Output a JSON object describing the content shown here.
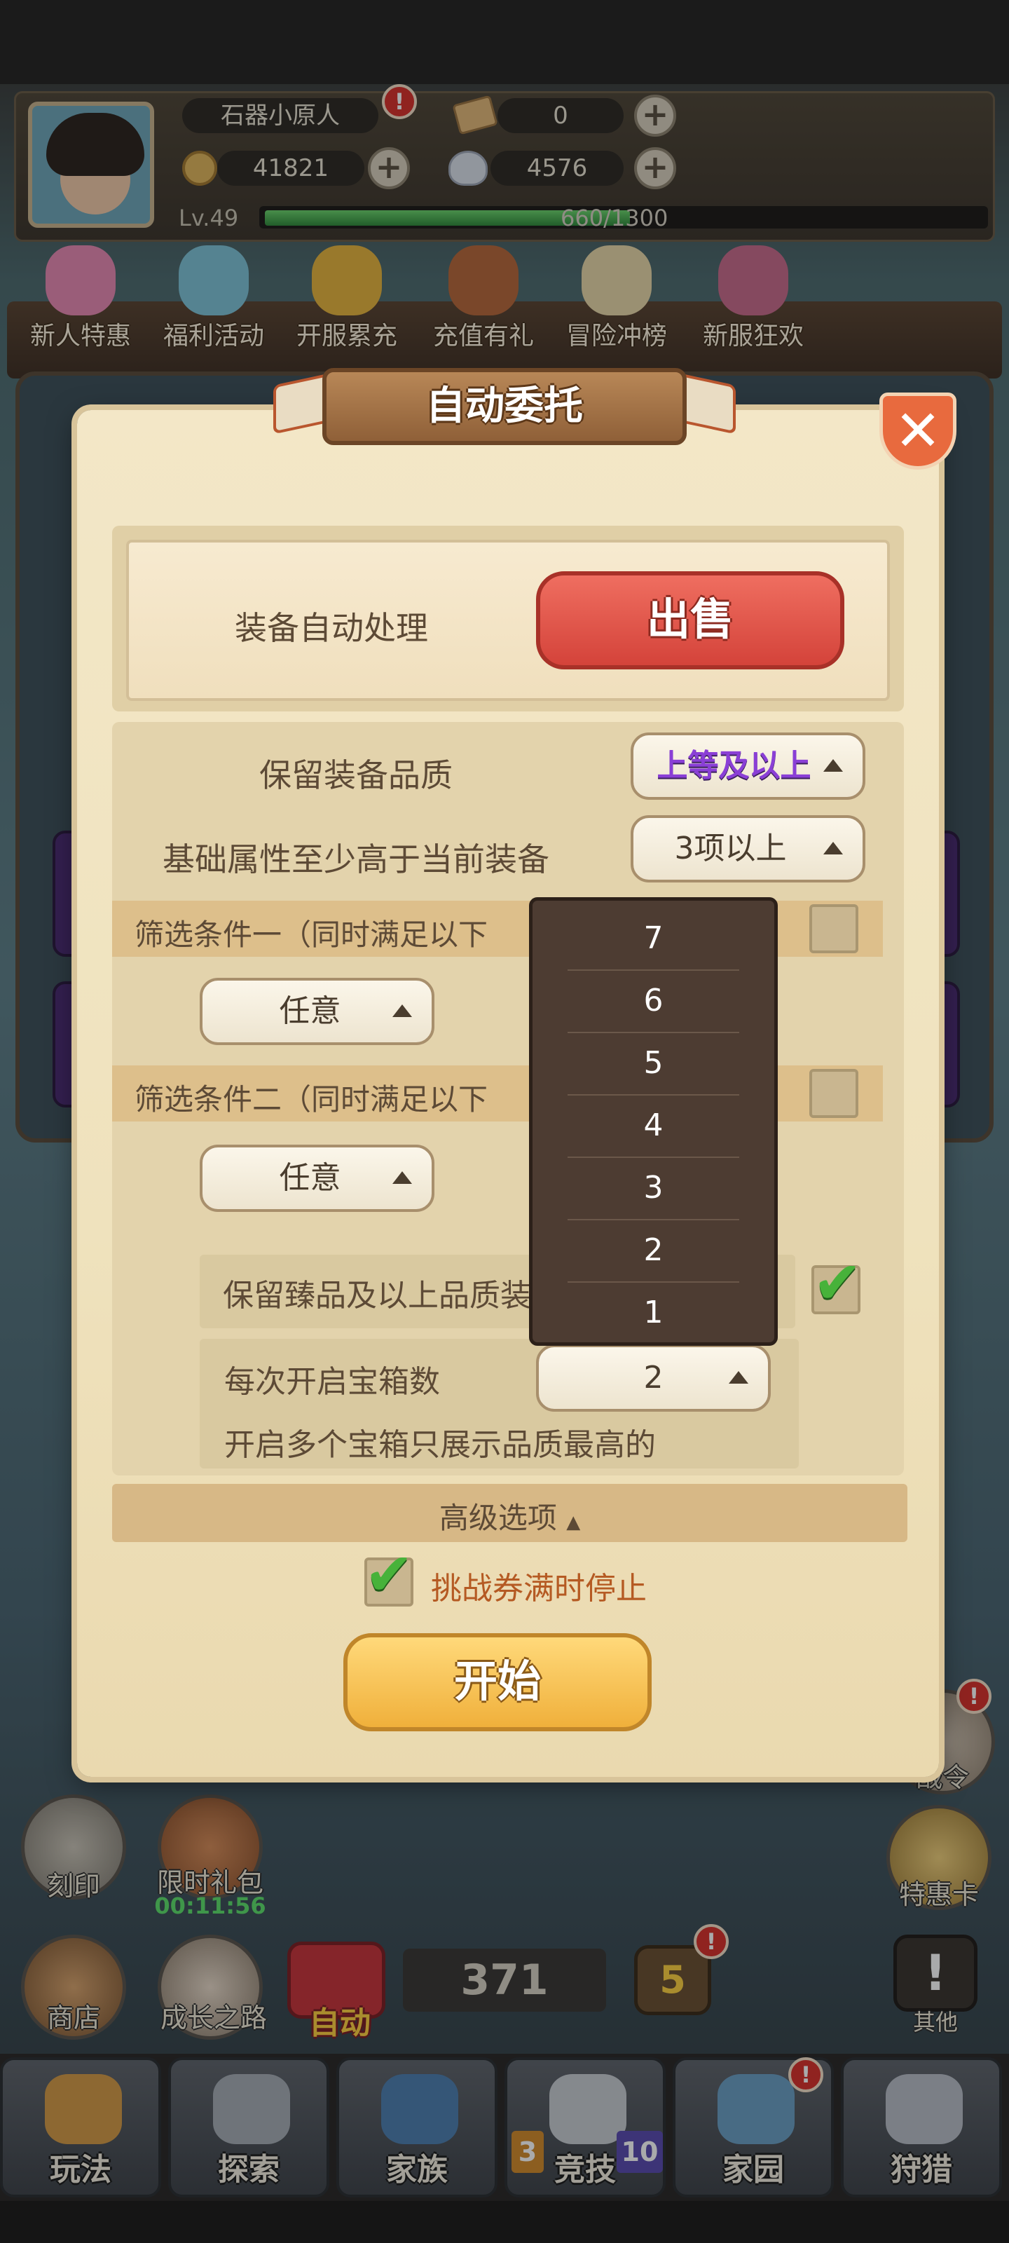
{
  "header": {
    "player_name": "石器小原人",
    "ticket_count": "0",
    "coin_count": "41821",
    "shell_count": "4576",
    "level": "Lv.49",
    "exp": "660/1300",
    "exp_progress": 0.508,
    "name_badge": "!"
  },
  "events": [
    {
      "label": "新人特惠",
      "badge": "!"
    },
    {
      "label": "福利活动"
    },
    {
      "label": "开服累充"
    },
    {
      "label": "充值有礼"
    },
    {
      "label": "冒险冲榜"
    },
    {
      "label": "新服狂欢"
    }
  ],
  "modal": {
    "title": "自动委托",
    "close_icon": "close-icon",
    "equip_auto_label": "装备自动处理",
    "sell_button": "出售",
    "keep_quality_label": "保留装备品质",
    "keep_quality_value": "上等及以上",
    "base_attr_label": "基础属性至少高于当前装备",
    "base_attr_value": "3项以上",
    "filter1_label": "筛选条件一（同时满足以下",
    "filter1_select": "任意",
    "filter2_label": "筛选条件二（同时满足以下",
    "filter2_select": "任意",
    "keep_rare_label": "保留臻品及以上品质装",
    "chests_label": "每次开启宝箱数",
    "chests_value": "2",
    "chests_note": "开启多个宝箱只展示品质最高的",
    "advanced_label": "高级选项",
    "stop_label": "挑战券满时停止",
    "start_button": "开始"
  },
  "dropdown_options": [
    "7",
    "6",
    "5",
    "4",
    "3",
    "2",
    "1"
  ],
  "hud": {
    "engrave": "刻印",
    "limited_pack": "限时礼包",
    "limited_timer": "00:11:56",
    "shop": "商店",
    "growth": "成长之路",
    "auto": "自动",
    "counter": "371",
    "level_badge": "5",
    "battle_pass": "战令",
    "special_card": "特惠卡",
    "other": "其他"
  },
  "tabs": [
    {
      "label": "玩法"
    },
    {
      "label": "探索"
    },
    {
      "label": "家族"
    },
    {
      "label": "竞技",
      "left_num": "3",
      "right_num": "10"
    },
    {
      "label": "家园",
      "badge": "!"
    },
    {
      "label": "狩猎"
    }
  ],
  "colors": {
    "sell_red": "#d4433a",
    "start_gold": "#f0b03b",
    "purple_quality": "#8a3fd6",
    "dropdown_bg": "#4d3c32",
    "check_green": "#47b23a"
  }
}
